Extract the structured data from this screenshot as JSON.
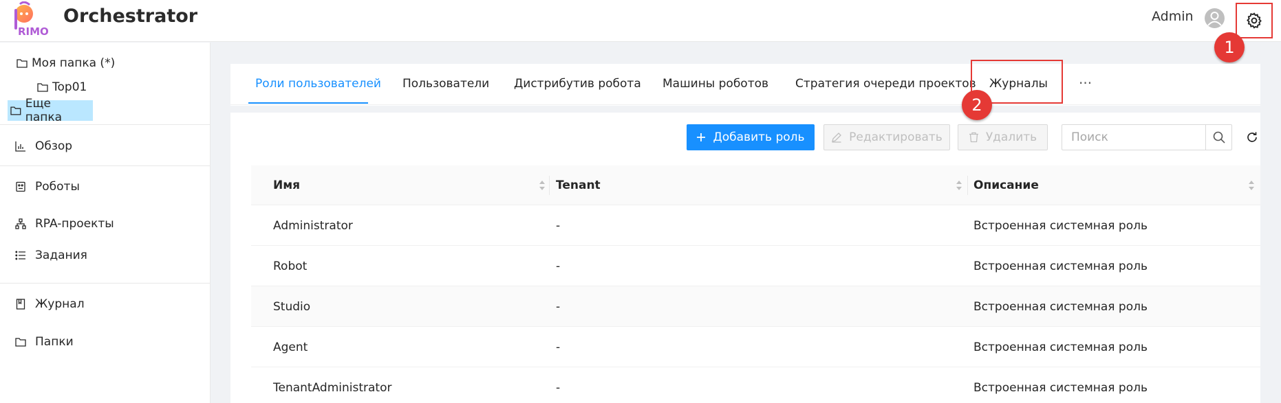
{
  "header": {
    "app_title": "Orchestrator",
    "logo_text": "RIMO",
    "user_name": "Admin",
    "settings_icon": "gear-icon",
    "avatar_icon": "user-icon"
  },
  "annotations": {
    "callout_1": "1",
    "callout_2": "2",
    "highlight_color": "#e53935"
  },
  "folders": [
    {
      "label": "Моя папка (*)",
      "icon": "folder-icon",
      "selected": false
    },
    {
      "label": "Top01",
      "icon": "folder-icon",
      "selected": false
    },
    {
      "label": "Еще папка",
      "icon": "folder-icon",
      "selected": true
    }
  ],
  "nav": [
    {
      "label": "Обзор",
      "icon": "bar-chart-icon"
    },
    {
      "label": "Роботы",
      "icon": "robot-icon"
    },
    {
      "label": "RPA-проекты",
      "icon": "sitemap-icon"
    },
    {
      "label": "Задания",
      "icon": "list-icon"
    },
    {
      "label": "Журнал",
      "icon": "book-icon"
    },
    {
      "label": "Папки",
      "icon": "folder-icon"
    }
  ],
  "tabs": [
    {
      "label": "Роли пользователей",
      "active": true
    },
    {
      "label": "Пользователи",
      "active": false
    },
    {
      "label": "Дистрибутив робота",
      "active": false
    },
    {
      "label": "Машины роботов",
      "active": false
    },
    {
      "label": "Стратегия очереди проектов",
      "active": false
    },
    {
      "label": "Журналы",
      "active": false
    },
    {
      "label": "···",
      "active": false
    }
  ],
  "toolbar": {
    "add_label": "Добавить роль",
    "edit_label": "Редактировать",
    "delete_label": "Удалить",
    "search_placeholder": "Поиск"
  },
  "table": {
    "columns": [
      "Имя",
      "Tenant",
      "Описание"
    ],
    "rows": [
      [
        "Administrator",
        "-",
        "Встроенная системная роль"
      ],
      [
        "Robot",
        "-",
        "Встроенная системная роль"
      ],
      [
        "Studio",
        "-",
        "Встроенная системная роль"
      ],
      [
        "Agent",
        "-",
        "Встроенная системная роль"
      ],
      [
        "TenantAdministrator",
        "-",
        "Встроенная системная роль"
      ]
    ]
  },
  "colors": {
    "primary": "#1890ff",
    "selected_folder": "#bae7ff",
    "annotation": "#e53935"
  }
}
